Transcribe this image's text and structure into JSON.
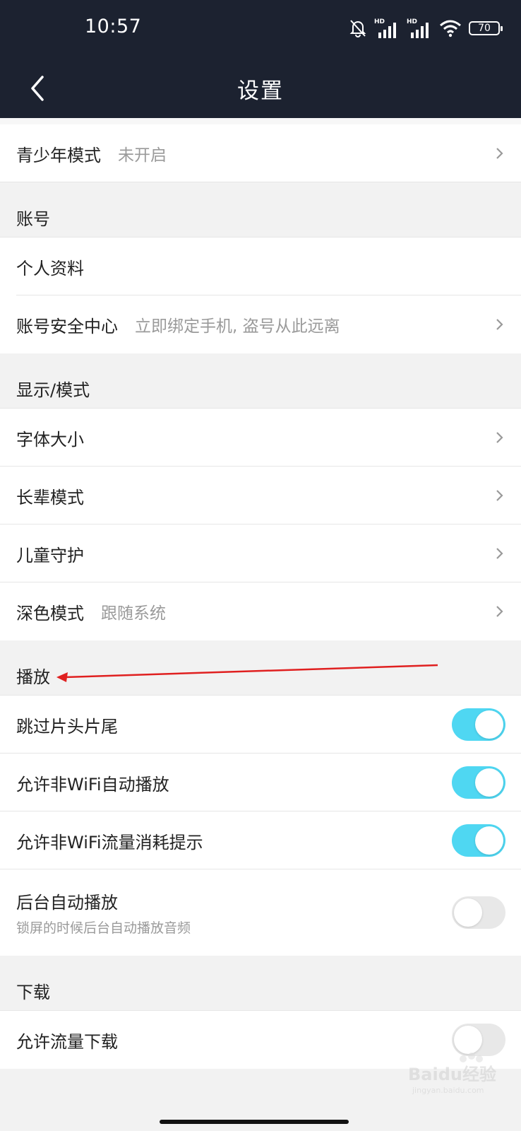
{
  "statusbar": {
    "time": "10:57",
    "hd1": "HD",
    "hd2": "HD",
    "battery": "70"
  },
  "header": {
    "title": "设置"
  },
  "rows": {
    "youth": {
      "label": "青少年模式",
      "value": "未开启"
    },
    "account_header": "账号",
    "profile": {
      "label": "个人资料"
    },
    "security": {
      "label": "账号安全中心",
      "value": "立即绑定手机, 盗号从此远离"
    },
    "display_header": "显示/模式",
    "font_size": {
      "label": "字体大小"
    },
    "elder": {
      "label": "长辈模式"
    },
    "child": {
      "label": "儿童守护"
    },
    "dark": {
      "label": "深色模式",
      "value": "跟随系统"
    },
    "play_header": "播放",
    "skip": {
      "label": "跳过片头片尾",
      "on": true
    },
    "nonwifi_autoplay": {
      "label": "允许非WiFi自动播放",
      "on": true
    },
    "nonwifi_tip": {
      "label": "允许非WiFi流量消耗提示",
      "on": true
    },
    "bg_play": {
      "label": "后台自动播放",
      "desc": "锁屏的时候后台自动播放音频",
      "on": false
    },
    "download_header": "下载",
    "cell_download": {
      "label": "允许流量下载",
      "on": false
    }
  },
  "watermark": {
    "text": "Baidu经验",
    "url": "jingyan.baidu.com"
  },
  "colors": {
    "toggle_on": "#4fd7f2",
    "header_bg": "#1c2230",
    "annotation_arrow": "#e02020"
  }
}
